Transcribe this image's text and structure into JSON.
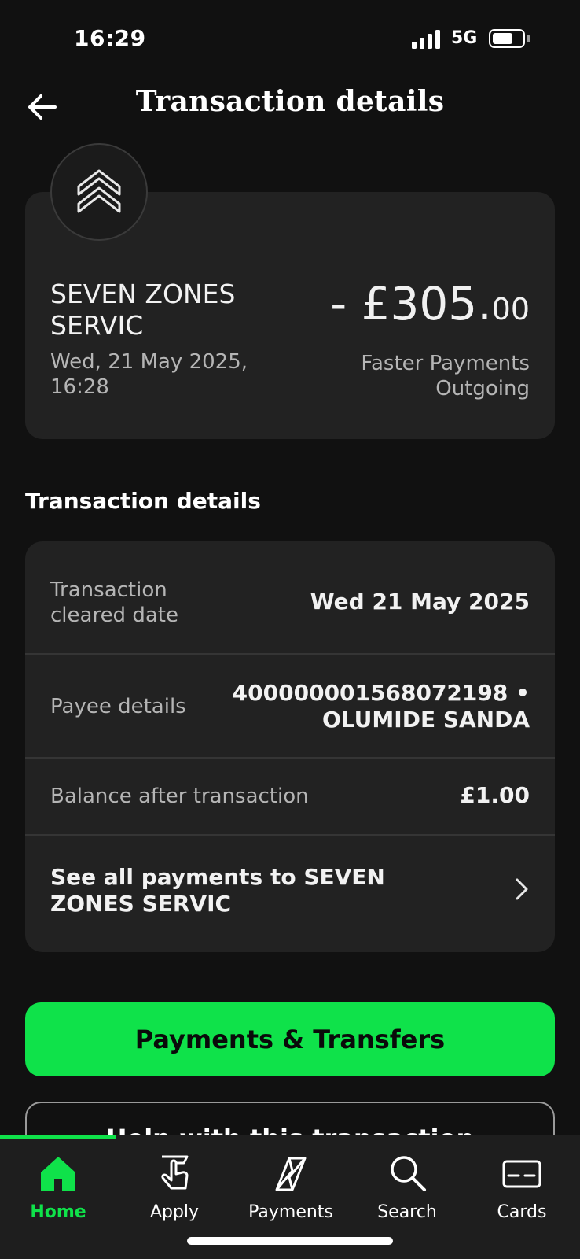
{
  "status_bar": {
    "time": "16:29",
    "network": "5G",
    "icons": [
      "signal-icon",
      "battery-icon"
    ]
  },
  "header": {
    "title": "Transaction details",
    "back_icon": "arrow-left-icon"
  },
  "summary": {
    "logo_icon": "chevron-stack-up-icon",
    "merchant": "SEVEN ZONES SERVIC",
    "date": "Wed, 21 May 2025, 16:28",
    "amount_main": "- £305.",
    "amount_pence": "00",
    "payment_type": "Faster Payments Outgoing"
  },
  "details": {
    "section_title": "Transaction details",
    "rows": [
      {
        "label": "Transaction cleared date",
        "value": "Wed 21 May 2025"
      },
      {
        "label": "Payee details",
        "value": "400000001568072198 • OLUMIDE SANDA"
      },
      {
        "label": "Balance after transaction",
        "value": "£1.00"
      }
    ],
    "see_all": "See all payments to SEVEN ZONES SERVIC"
  },
  "actions": {
    "primary": "Payments & Transfers",
    "secondary": "Help with this transaction"
  },
  "nav": {
    "items": [
      {
        "label": "Home",
        "icon": "home-icon",
        "active": true
      },
      {
        "label": "Apply",
        "icon": "apply-hand-icon",
        "active": false
      },
      {
        "label": "Payments",
        "icon": "payments-arrows-icon",
        "active": false
      },
      {
        "label": "Search",
        "icon": "search-icon",
        "active": false
      },
      {
        "label": "Cards",
        "icon": "card-icon",
        "active": false
      }
    ]
  },
  "colors": {
    "background": "#111111",
    "card": "#222222",
    "accent": "#0fe24a",
    "muted_text": "#b5b5b5"
  }
}
